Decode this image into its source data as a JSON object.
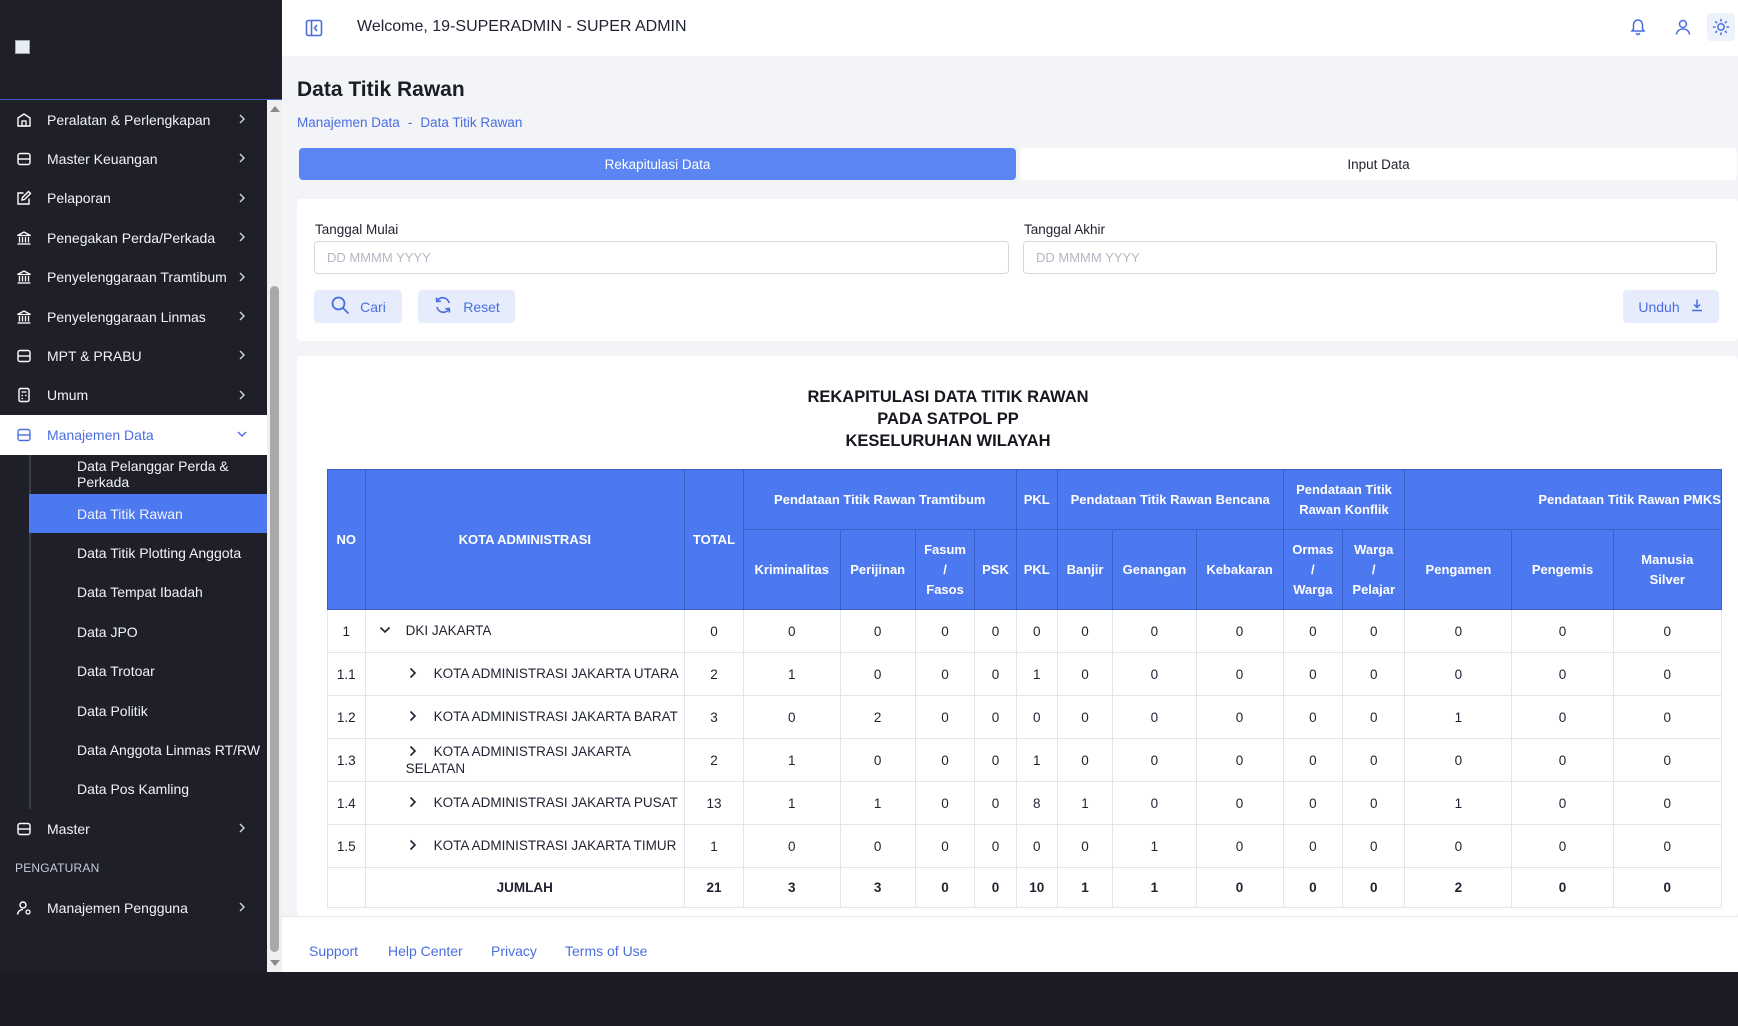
{
  "sidebar": {
    "logo_alt": "MANAJEMEN",
    "menu": [
      {
        "label": "Peralatan & Perlengkapan",
        "icon": "building-icon"
      },
      {
        "label": "Master Keuangan",
        "icon": "database-icon"
      },
      {
        "label": "Pelaporan",
        "icon": "edit-icon"
      },
      {
        "label": "Penegakan Perda/Perkada",
        "icon": "bank-icon"
      },
      {
        "label": "Penyelenggaraan Tramtibum",
        "icon": "bank-icon"
      },
      {
        "label": "Penyelenggaraan Linmas",
        "icon": "bank-icon"
      },
      {
        "label": "MPT & PRABU",
        "icon": "database-icon"
      },
      {
        "label": "Umum",
        "icon": "calculator-icon"
      }
    ],
    "open_menu": {
      "label": "Manajemen Data",
      "icon": "database-icon"
    },
    "submenu": [
      "Data Pelanggar Perda & Perkada",
      "Data Titik Rawan",
      "Data Titik Plotting Anggota",
      "Data Tempat Ibadah",
      "Data JPO",
      "Data Trotoar",
      "Data Politik",
      "Data Anggota Linmas RT/RW",
      "Data Pos Kamling"
    ],
    "active_submenu": "Data Titik Rawan",
    "after_menu": {
      "label": "Master",
      "icon": "database-icon"
    },
    "section": "PENGATURAN",
    "settings_menu": {
      "label": "Manajemen Pengguna",
      "icon": "user-settings-icon"
    }
  },
  "topbar": {
    "welcome": "Welcome, 19-SUPERADMIN - SUPER ADMIN"
  },
  "page": {
    "title": "Data Titik Rawan",
    "breadcrumb": [
      "Manajemen Data",
      "-",
      "Data Titik Rawan"
    ]
  },
  "tabs": [
    {
      "label": "Rekapitulasi Data",
      "active": true
    },
    {
      "label": "Input Data",
      "active": false
    }
  ],
  "filters": {
    "start_label": "Tanggal Mulai",
    "start_placeholder": "DD MMMM YYYY",
    "end_label": "Tanggal Akhir",
    "end_placeholder": "DD MMMM YYYY",
    "search_button": "Cari",
    "reset_button": "Reset",
    "download_button": "Unduh"
  },
  "report": {
    "title_lines": [
      "REKAPITULASI DATA TITIK RAWAN",
      "PADA SATPOL PP",
      "KESELURUHAN WILAYAH"
    ],
    "header_top": {
      "no": "NO",
      "kota": "KOTA ADMINISTRASI",
      "total": "TOTAL",
      "tramtibum": "Pendataan Titik Rawan Tramtibum",
      "pkl": "PKL",
      "bencana": "Pendataan Titik Rawan Bencana",
      "konflik": "Pendataan Titik Rawan Konflik",
      "pmks": "Pendataan Titik Rawan PMKS"
    },
    "header_sub": [
      "Kriminalitas",
      "Perijinan",
      "Fasum / Fasos",
      "PSK",
      "PKL",
      "Banjir",
      "Genangan",
      "Kebakaran",
      "Ormas / Warga",
      "Warga / Pelajar",
      "Pengamen",
      "Pengemis",
      "Manusia Silver"
    ],
    "rows": [
      {
        "no": "1",
        "kota": "DKI JAKARTA",
        "expanded": true,
        "level": 0,
        "total": "0",
        "values": [
          "0",
          "0",
          "0",
          "0",
          "0",
          "0",
          "0",
          "0",
          "0",
          "0",
          "0",
          "0",
          "0"
        ]
      },
      {
        "no": "1.1",
        "kota": "KOTA ADMINISTRASI JAKARTA UTARA",
        "expanded": false,
        "level": 1,
        "total": "2",
        "values": [
          "1",
          "0",
          "0",
          "0",
          "1",
          "0",
          "0",
          "0",
          "0",
          "0",
          "0",
          "0",
          "0"
        ]
      },
      {
        "no": "1.2",
        "kota": "KOTA ADMINISTRASI JAKARTA BARAT",
        "expanded": false,
        "level": 1,
        "total": "3",
        "values": [
          "0",
          "2",
          "0",
          "0",
          "0",
          "0",
          "0",
          "0",
          "0",
          "0",
          "1",
          "0",
          "0"
        ]
      },
      {
        "no": "1.3",
        "kota": "KOTA ADMINISTRASI JAKARTA SELATAN",
        "expanded": false,
        "level": 1,
        "total": "2",
        "values": [
          "1",
          "0",
          "0",
          "0",
          "1",
          "0",
          "0",
          "0",
          "0",
          "0",
          "0",
          "0",
          "0"
        ]
      },
      {
        "no": "1.4",
        "kota": "KOTA ADMINISTRASI JAKARTA PUSAT",
        "expanded": false,
        "level": 1,
        "total": "13",
        "values": [
          "1",
          "1",
          "0",
          "0",
          "8",
          "1",
          "0",
          "0",
          "0",
          "0",
          "1",
          "0",
          "0"
        ]
      },
      {
        "no": "1.5",
        "kota": "KOTA ADMINISTRASI JAKARTA TIMUR",
        "expanded": false,
        "level": 1,
        "total": "1",
        "values": [
          "0",
          "0",
          "0",
          "0",
          "0",
          "0",
          "1",
          "0",
          "0",
          "0",
          "0",
          "0",
          "0"
        ]
      }
    ],
    "total_row": {
      "label": "JUMLAH",
      "total": "21",
      "values": [
        "3",
        "3",
        "0",
        "0",
        "10",
        "1",
        "1",
        "0",
        "0",
        "0",
        "2",
        "0",
        "0"
      ]
    }
  },
  "footer": {
    "links": [
      "Support",
      "Help Center",
      "Privacy",
      "Terms of Use"
    ]
  },
  "colors": {
    "accent": "#4d79f0",
    "sidebar_bg": "#1e1f29",
    "link": "#4a6ee0"
  }
}
